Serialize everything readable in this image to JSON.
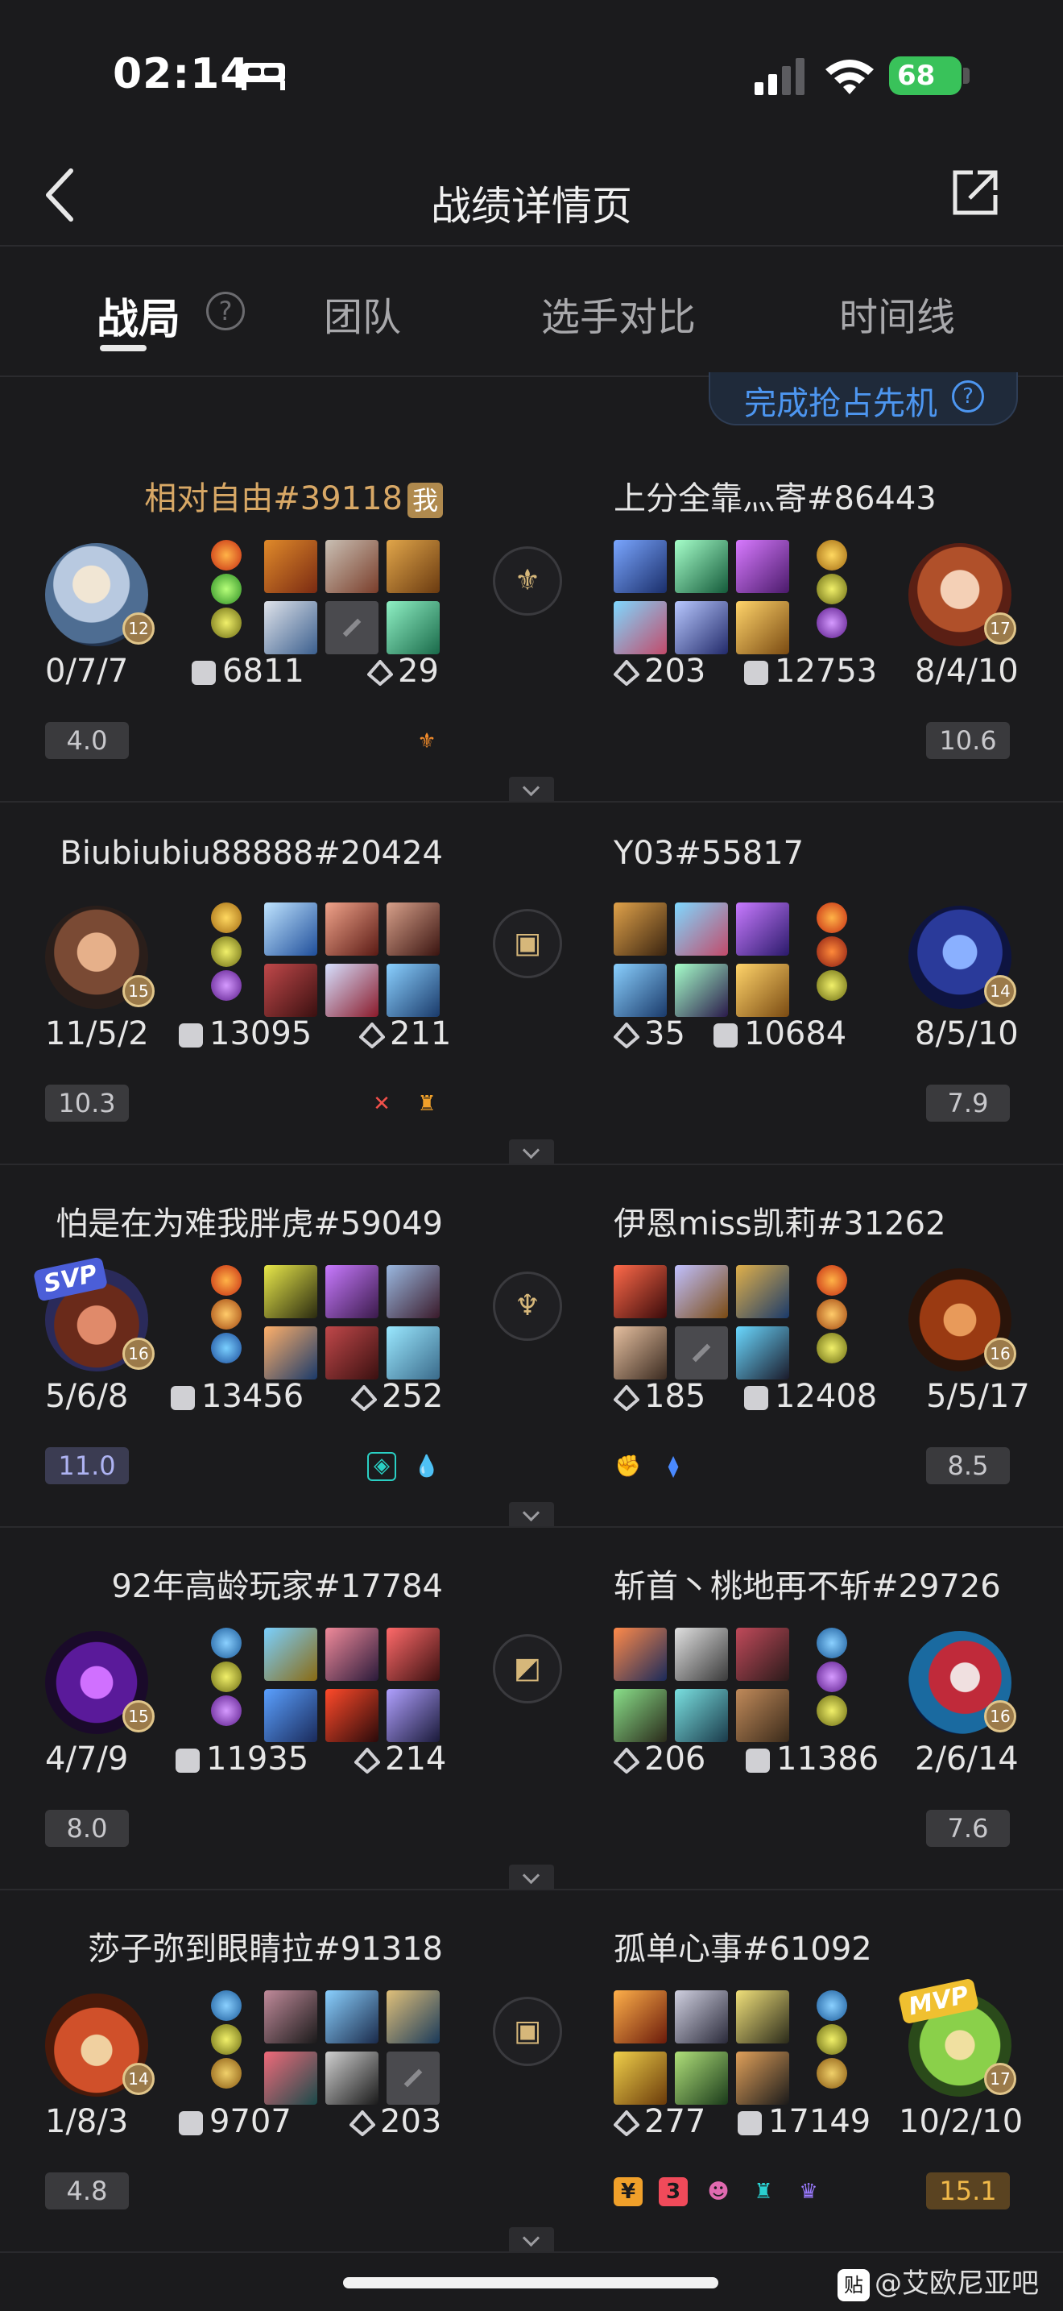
{
  "status_bar": {
    "time": "02:14",
    "battery": "68"
  },
  "header": {
    "title": "战绩详情页"
  },
  "tabs": [
    {
      "label": "战局"
    },
    {
      "label": "团队"
    },
    {
      "label": "选手对比"
    },
    {
      "label": "时间线"
    }
  ],
  "first_blood_badge": {
    "label": "完成抢占先机"
  },
  "rows": [
    {
      "left": {
        "name": "相对自由#39118",
        "me_tag": "我",
        "level": "12",
        "kda": "0/7/7",
        "gold": "6811",
        "score_points": "29",
        "rating": "4.0"
      },
      "right": {
        "name": "上分全靠灬寄#86443",
        "level": "17",
        "kda": "8/4/10",
        "gold": "12753",
        "score_points": "203",
        "rating": "10.6"
      }
    },
    {
      "left": {
        "name": "Biubiubiu88888#20424",
        "level": "15",
        "kda": "11/5/2",
        "gold": "13095",
        "score_points": "211",
        "rating": "10.3"
      },
      "right": {
        "name": "Y03#55817",
        "level": "14",
        "kda": "8/5/10",
        "gold": "10684",
        "score_points": "35",
        "rating": "7.9"
      }
    },
    {
      "left": {
        "name": "怕是在为难我胖虎#59049",
        "level": "16",
        "kda": "5/6/8",
        "gold": "13456",
        "score_points": "252",
        "rating": "11.0",
        "badge": "SVP"
      },
      "right": {
        "name": "伊恩miss凯莉#31262",
        "level": "16",
        "kda": "5/5/17",
        "gold": "12408",
        "score_points": "185",
        "rating": "8.5"
      }
    },
    {
      "left": {
        "name": "92年高龄玩家#17784",
        "level": "15",
        "kda": "4/7/9",
        "gold": "11935",
        "score_points": "214",
        "rating": "8.0"
      },
      "right": {
        "name": "斩首丶桃地再不斩#29726",
        "level": "16",
        "kda": "2/6/14",
        "gold": "11386",
        "score_points": "206",
        "rating": "7.6"
      }
    },
    {
      "left": {
        "name": "莎子弥到眼睛拉#91318",
        "level": "14",
        "kda": "1/8/3",
        "gold": "9707",
        "score_points": "203",
        "rating": "4.8"
      },
      "right": {
        "name": "孤单心事#61092",
        "level": "17",
        "kda": "10/2/10",
        "gold": "17149",
        "score_points": "277",
        "rating": "15.1",
        "badge": "MVP"
      }
    }
  ],
  "watermark": {
    "logo": "贴",
    "text": "@艾欧尼亚吧"
  }
}
